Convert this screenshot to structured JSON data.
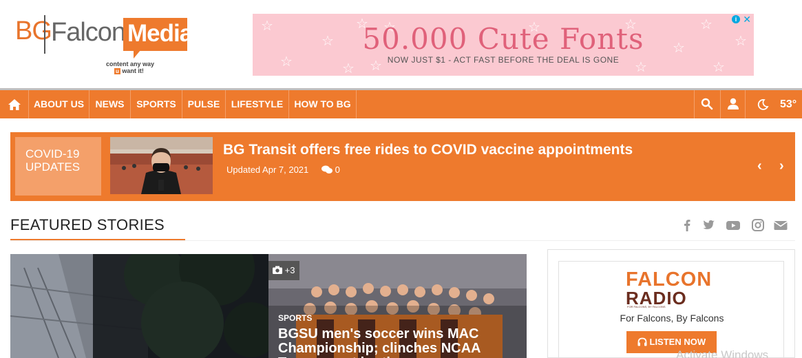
{
  "header": {
    "logo": {
      "bg": "BG",
      "falcon": "Falcon",
      "media": "Media",
      "tagline_line1": "content any way",
      "tagline_u": "u",
      "tagline_line2": "want it!"
    },
    "ad": {
      "headline": "50.000 Cute Fonts",
      "subline": "NOW JUST $1 - ACT FAST BEFORE THE DEAL IS GONE",
      "info_icon": "i",
      "close_icon": "✕"
    }
  },
  "nav": {
    "home_icon": "home-icon",
    "items": [
      {
        "label": "ABOUT US"
      },
      {
        "label": "NEWS"
      },
      {
        "label": "SPORTS"
      },
      {
        "label": "PULSE"
      },
      {
        "label": "LIFESTYLE"
      },
      {
        "label": "HOW TO BG"
      }
    ],
    "temperature": "53°"
  },
  "breaking": {
    "tag": "COVID-19 UPDATES",
    "headline": "BG Transit offers free rides to COVID vaccine appointments",
    "updated": "Updated Apr 7, 2021",
    "comment_count": "0",
    "prev_icon": "‹",
    "next_icon": "›"
  },
  "featured": {
    "title": "FEATURED STORIES",
    "social_icons": [
      "facebook-icon",
      "twitter-icon",
      "youtube-icon",
      "instagram-icon",
      "email-icon"
    ],
    "stories": [
      {
        "photo_count": "+3",
        "section": "SPORTS",
        "title": "BGSU men's soccer wins MAC Championship; clinches NCAA Tournament berth"
      }
    ]
  },
  "sidebar": {
    "radio_top": "FALCON",
    "radio_bottom": "RADIO",
    "radio_small": "FOR FALCONS, BY FALCONS",
    "tagline": "For Falcons, By Falcons",
    "listen_label": "LISTEN NOW"
  },
  "watermark": "Activate Windows",
  "colors": {
    "brand_orange": "#ee7a2d",
    "light_orange": "#f4a06a",
    "radio_brown": "#6b2d1f",
    "ad_pink": "#fbc9d1"
  }
}
